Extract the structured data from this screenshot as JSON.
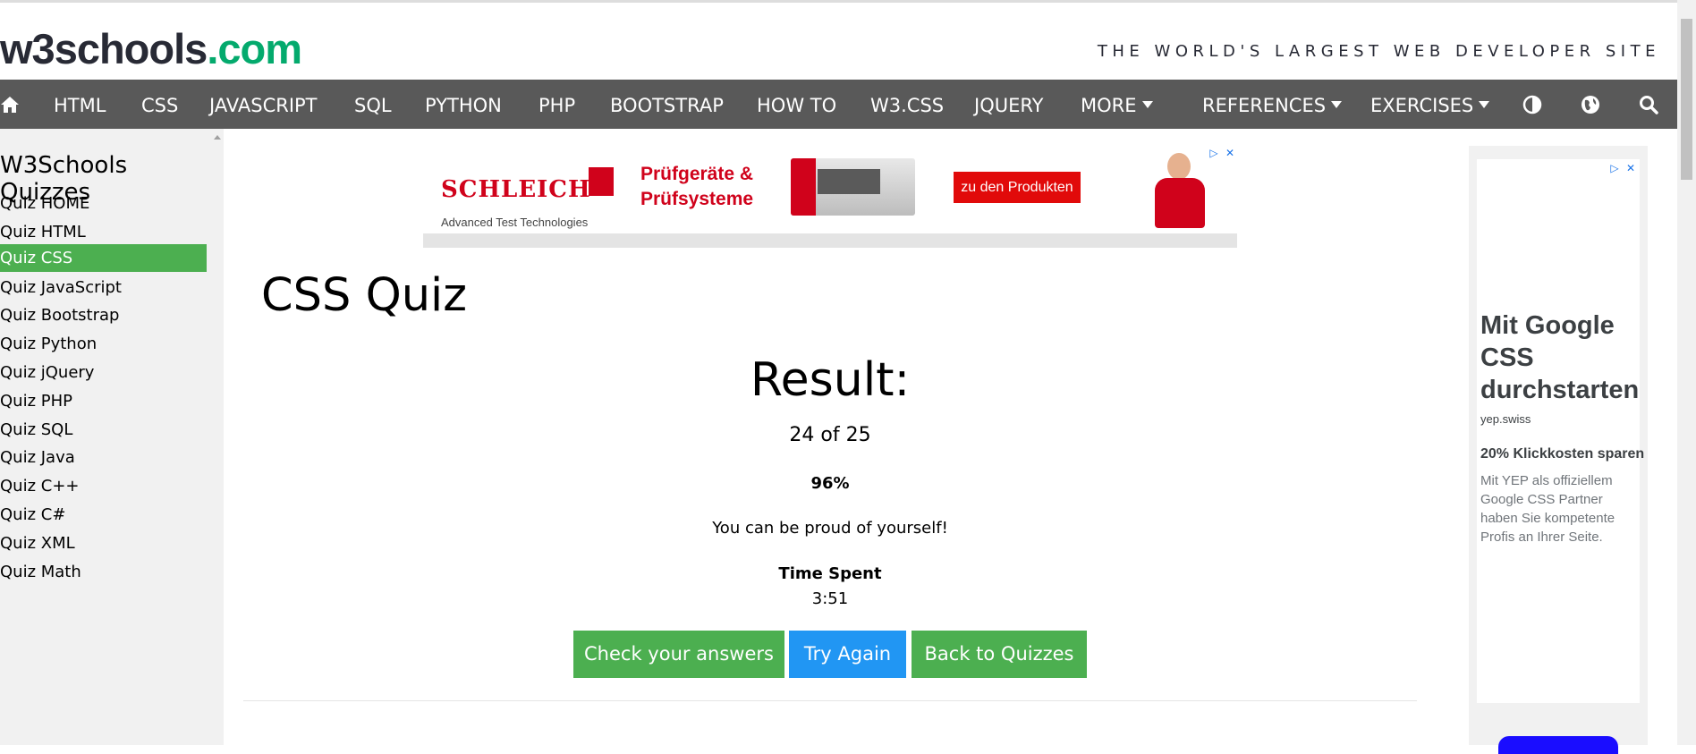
{
  "header": {
    "logo_main": "w3schools",
    "logo_com": ".com",
    "tagline": "THE WORLD'S LARGEST WEB DEVELOPER SITE"
  },
  "nav": {
    "home_icon": "home-icon",
    "items": [
      "HTML",
      "CSS",
      "JAVASCRIPT",
      "SQL",
      "PYTHON",
      "PHP",
      "BOOTSTRAP",
      "HOW TO",
      "W3.CSS",
      "JQUERY"
    ],
    "more": "MORE",
    "references": "REFERENCES",
    "exercises": "EXERCISES",
    "icons": [
      "contrast-icon",
      "globe-icon",
      "search-icon"
    ]
  },
  "sidebar": {
    "title": "W3Schools Quizzes",
    "items": [
      "Quiz HOME",
      "Quiz HTML",
      "Quiz CSS",
      "Quiz JavaScript",
      "Quiz Bootstrap",
      "Quiz Python",
      "Quiz jQuery",
      "Quiz PHP",
      "Quiz SQL",
      "Quiz Java",
      "Quiz C++",
      "Quiz C#",
      "Quiz XML",
      "Quiz Math"
    ],
    "active_index": 2
  },
  "ad_top": {
    "brand": "SCHLEICH",
    "brand_sub": "Advanced Test Technologies",
    "headline": "Prüfgeräte &\nPrüfsysteme",
    "cta": "zu den Produkten"
  },
  "main": {
    "title": "CSS Quiz",
    "result_title": "Result:",
    "score": "24 of 25",
    "percent": "96%",
    "message": "You can be proud of yourself!",
    "time_label": "Time Spent",
    "time_value": "3:51",
    "buttons": {
      "check": "Check your answers",
      "try": "Try Again",
      "back": "Back to Quizzes"
    }
  },
  "ad_right": {
    "headline": "Mit Google\nCSS\ndurchstarten",
    "domain": "yep.swiss",
    "subhead": "20% Klickkosten sparen",
    "body": "Mit YEP als offiziellem\nGoogle CSS Partner\nhaben Sie kompetente\nProfis an Ihrer Seite."
  },
  "colors": {
    "nav_bg": "#595959",
    "accent_green": "#4CAF50",
    "accent_blue": "#2196F3",
    "brand_green": "#04AA6D",
    "sidebar_bg": "#f1f1f1"
  }
}
